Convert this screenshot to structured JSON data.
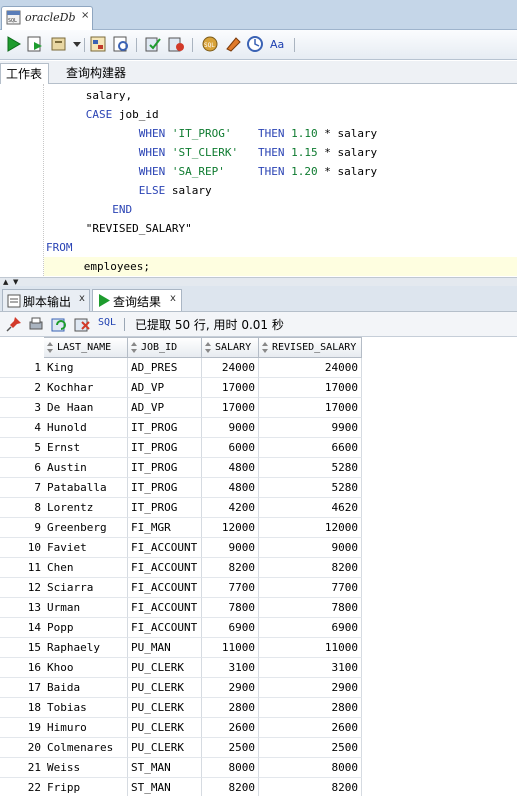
{
  "document_tab": {
    "title": "oracleDb",
    "close": "×"
  },
  "toolbar": {
    "buttons": [
      "run-statement-icon",
      "run-script-icon",
      "commit-icon",
      "dropdown-icon",
      "explain-plan-icon",
      "autotrace-icon",
      "commit-transaction-icon",
      "rollback-icon",
      "sql-tuning-icon",
      "clear-icon",
      "history-icon",
      "format-case-icon"
    ]
  },
  "sheet_tabs": [
    {
      "label": "工作表",
      "active": true
    },
    {
      "label": "查询构建器",
      "active": false
    }
  ],
  "editor": {
    "lines": [
      [
        {
          "t": "      salary,",
          "c": "pl"
        }
      ],
      [
        {
          "t": "      ",
          "c": "pl"
        },
        {
          "t": "CASE",
          "c": "kw"
        },
        {
          "t": " job_id",
          "c": "pl"
        }
      ],
      [
        {
          "t": "              ",
          "c": "pl"
        },
        {
          "t": "WHEN",
          "c": "kw"
        },
        {
          "t": " ",
          "c": "pl"
        },
        {
          "t": "'IT_PROG'",
          "c": "str"
        },
        {
          "t": "    ",
          "c": "pl"
        },
        {
          "t": "THEN",
          "c": "kw"
        },
        {
          "t": " ",
          "c": "pl"
        },
        {
          "t": "1.10",
          "c": "num"
        },
        {
          "t": " * salary",
          "c": "pl"
        }
      ],
      [
        {
          "t": "              ",
          "c": "pl"
        },
        {
          "t": "WHEN",
          "c": "kw"
        },
        {
          "t": " ",
          "c": "pl"
        },
        {
          "t": "'ST_CLERK'",
          "c": "str"
        },
        {
          "t": "   ",
          "c": "pl"
        },
        {
          "t": "THEN",
          "c": "kw"
        },
        {
          "t": " ",
          "c": "pl"
        },
        {
          "t": "1.15",
          "c": "num"
        },
        {
          "t": " * salary",
          "c": "pl"
        }
      ],
      [
        {
          "t": "              ",
          "c": "pl"
        },
        {
          "t": "WHEN",
          "c": "kw"
        },
        {
          "t": " ",
          "c": "pl"
        },
        {
          "t": "'SA_REP'",
          "c": "str"
        },
        {
          "t": "     ",
          "c": "pl"
        },
        {
          "t": "THEN",
          "c": "kw"
        },
        {
          "t": " ",
          "c": "pl"
        },
        {
          "t": "1.20",
          "c": "num"
        },
        {
          "t": " * salary",
          "c": "pl"
        }
      ],
      [
        {
          "t": "              ",
          "c": "pl"
        },
        {
          "t": "ELSE",
          "c": "kw"
        },
        {
          "t": " salary",
          "c": "pl"
        }
      ],
      [
        {
          "t": "          ",
          "c": "pl"
        },
        {
          "t": "END",
          "c": "kw"
        }
      ],
      [
        {
          "t": "      \"REVISED_SALARY\"",
          "c": "pl"
        }
      ],
      [
        {
          "t": "FROM",
          "c": "kw"
        }
      ],
      [
        {
          "t": "      employees;",
          "c": "pl"
        }
      ]
    ],
    "current_line": 9
  },
  "output_tabs": [
    {
      "label": "脚本输出",
      "close": "x",
      "active": false
    },
    {
      "label": "查询结果",
      "close": "x",
      "active": true
    }
  ],
  "result_toolbar": {
    "sql_label": "SQL",
    "status": "已提取 50 行, 用时 0.01 秒"
  },
  "grid": {
    "columns": [
      "LAST_NAME",
      "JOB_ID",
      "SALARY",
      "REVISED_SALARY"
    ],
    "rows": [
      [
        "1",
        "King",
        "AD_PRES",
        "24000",
        "24000"
      ],
      [
        "2",
        "Kochhar",
        "AD_VP",
        "17000",
        "17000"
      ],
      [
        "3",
        "De Haan",
        "AD_VP",
        "17000",
        "17000"
      ],
      [
        "4",
        "Hunold",
        "IT_PROG",
        "9000",
        "9900"
      ],
      [
        "5",
        "Ernst",
        "IT_PROG",
        "6000",
        "6600"
      ],
      [
        "6",
        "Austin",
        "IT_PROG",
        "4800",
        "5280"
      ],
      [
        "7",
        "Pataballa",
        "IT_PROG",
        "4800",
        "5280"
      ],
      [
        "8",
        "Lorentz",
        "IT_PROG",
        "4200",
        "4620"
      ],
      [
        "9",
        "Greenberg",
        "FI_MGR",
        "12000",
        "12000"
      ],
      [
        "10",
        "Faviet",
        "FI_ACCOUNT",
        "9000",
        "9000"
      ],
      [
        "11",
        "Chen",
        "FI_ACCOUNT",
        "8200",
        "8200"
      ],
      [
        "12",
        "Sciarra",
        "FI_ACCOUNT",
        "7700",
        "7700"
      ],
      [
        "13",
        "Urman",
        "FI_ACCOUNT",
        "7800",
        "7800"
      ],
      [
        "14",
        "Popp",
        "FI_ACCOUNT",
        "6900",
        "6900"
      ],
      [
        "15",
        "Raphaely",
        "PU_MAN",
        "11000",
        "11000"
      ],
      [
        "16",
        "Khoo",
        "PU_CLERK",
        "3100",
        "3100"
      ],
      [
        "17",
        "Baida",
        "PU_CLERK",
        "2900",
        "2900"
      ],
      [
        "18",
        "Tobias",
        "PU_CLERK",
        "2800",
        "2800"
      ],
      [
        "19",
        "Himuro",
        "PU_CLERK",
        "2600",
        "2600"
      ],
      [
        "20",
        "Colmenares",
        "PU_CLERK",
        "2500",
        "2500"
      ],
      [
        "21",
        "Weiss",
        "ST_MAN",
        "8000",
        "8000"
      ],
      [
        "22",
        "Fripp",
        "ST_MAN",
        "8200",
        "8200"
      ]
    ]
  },
  "colors": {
    "keyword": "#2a43b4",
    "string": "#0d7a2f",
    "current_line_bg": "#fefee0",
    "tabbar_bg": "#c5d6e8"
  }
}
